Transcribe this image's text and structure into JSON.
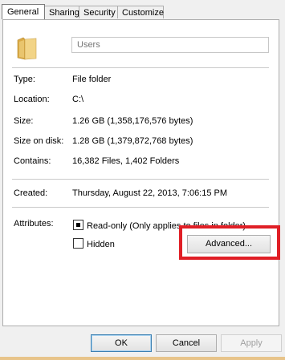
{
  "tabs": [
    "General",
    "Sharing",
    "Security",
    "Customize"
  ],
  "name_field": {
    "placeholder": "Users",
    "value": ""
  },
  "properties": [
    {
      "label": "Type:",
      "value": "File folder"
    },
    {
      "label": "Location:",
      "value": "C:\\"
    },
    {
      "label": "Size:",
      "value": "1.26 GB (1,358,176,576 bytes)"
    },
    {
      "label": "Size on disk:",
      "value": "1.28 GB (1,379,872,768 bytes)"
    },
    {
      "label": "Contains:",
      "value": "16,382 Files, 1,402 Folders"
    }
  ],
  "created": {
    "label": "Created:",
    "value": "Thursday, August 22, 2013, 7:06:15 PM"
  },
  "attributes": {
    "label": "Attributes:",
    "read_only": {
      "label": "Read-only (Only applies to files in folder)",
      "state": "indeterminate"
    },
    "hidden": {
      "label": "Hidden",
      "checked": false
    },
    "advanced_label": "Advanced..."
  },
  "buttons": {
    "ok": "OK",
    "cancel": "Cancel",
    "apply": "Apply"
  },
  "colors": {
    "highlight": "#e01f26",
    "folder": "#e9c56e"
  },
  "icons": {
    "folder": "folder-icon"
  }
}
